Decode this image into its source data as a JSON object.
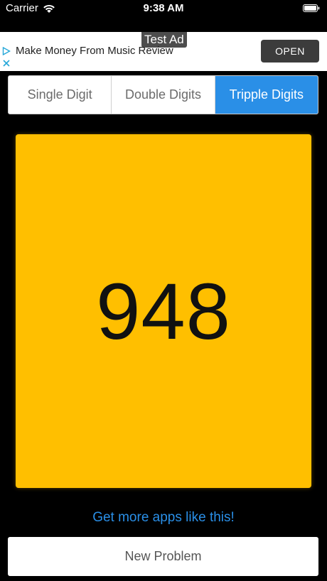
{
  "status_bar": {
    "carrier": "Carrier",
    "time": "9:38 AM"
  },
  "ad": {
    "tag": "Test Ad",
    "text": "Make Money From Music Review",
    "open_label": "OPEN"
  },
  "segments": [
    {
      "label": "Single Digit",
      "selected": false
    },
    {
      "label": "Double Digits",
      "selected": false
    },
    {
      "label": "Tripple Digits",
      "selected": true
    }
  ],
  "display": {
    "number": "948",
    "card_color": "#ffbf00"
  },
  "links": {
    "more_apps": "Get more apps like this!"
  },
  "actions": {
    "new_problem": "New Problem"
  },
  "colors": {
    "accent": "#2a8fe7",
    "background": "#000000"
  }
}
